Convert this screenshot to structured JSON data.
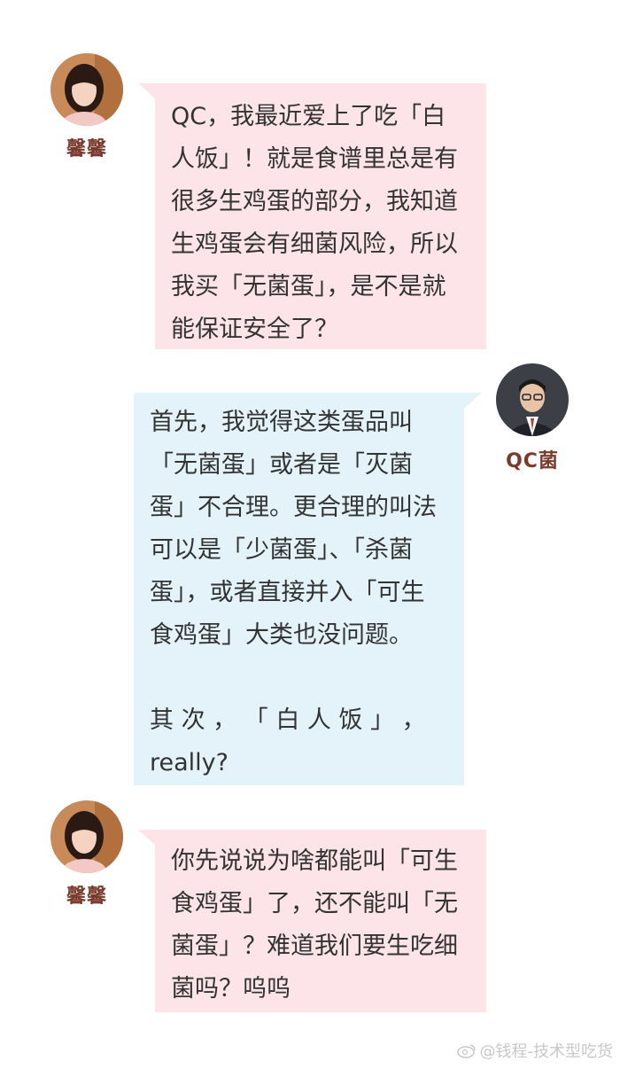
{
  "messages": [
    {
      "sender": "馨馨",
      "side": "left",
      "lines": [
        "QC，我最近爱上了吃「白",
        "人饭」！就是食谱里总是有",
        "很多生鸡蛋的部分，我知道",
        "生鸡蛋会有细菌风险，所以",
        "我买「无菌蛋」，是不是就",
        "能保证安全了？"
      ]
    },
    {
      "sender": "QC菌",
      "side": "right",
      "lines": [
        "首先，我觉得这类蛋品叫",
        "「无菌蛋」或者是「灭菌",
        "蛋」不合理。更合理的叫法",
        "可以是「少菌蛋」、「杀菌",
        "蛋」，或者直接并入「可生",
        "食鸡蛋」大类也没问题。",
        "",
        "其 次 ， 「 白 人 饭 」 ，",
        "really?"
      ]
    },
    {
      "sender": "馨馨",
      "side": "left",
      "lines": [
        "你先说说为啥都能叫「可生",
        "食鸡蛋」了，还不能叫「无",
        "菌蛋」？难道我们要生吃细",
        "菌吗？呜呜"
      ]
    }
  ],
  "watermark": "@钱程-技术型吃货",
  "colors": {
    "pink_bubble": "#fce4e8",
    "blue_bubble": "#e3f3f9",
    "name_color": "#7a3b2e"
  }
}
